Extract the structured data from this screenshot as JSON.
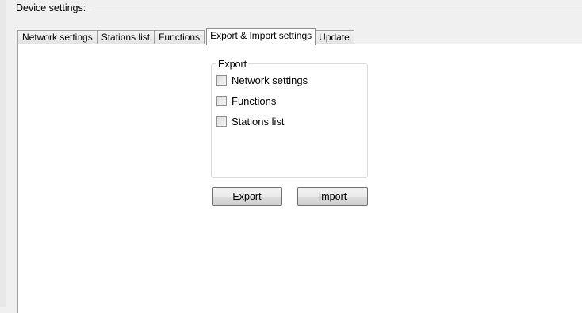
{
  "group": {
    "title": "Device settings:"
  },
  "tabs": [
    {
      "label": "Network settings"
    },
    {
      "label": "Stations list"
    },
    {
      "label": "Functions"
    },
    {
      "label": "Export & Import settings"
    },
    {
      "label": "Update"
    }
  ],
  "export_panel": {
    "legend": "Export",
    "options": [
      {
        "label": "Network settings",
        "checked": false
      },
      {
        "label": "Functions",
        "checked": false
      },
      {
        "label": "Stations list",
        "checked": false
      }
    ]
  },
  "buttons": {
    "export_label": "Export",
    "import_label": "Import"
  }
}
